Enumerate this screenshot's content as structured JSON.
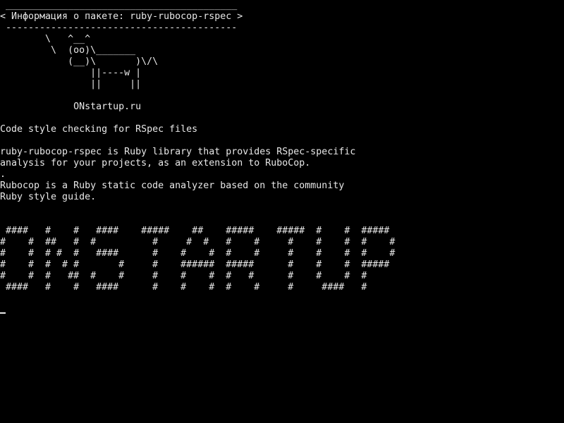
{
  "terminal": {
    "lines": [
      " _________________________________________",
      "< Информация о пакете: ruby-rubocop-rspec >",
      " -----------------------------------------",
      "        \\   ^__^",
      "         \\  (oo)\\_______",
      "            (__)\\       )\\/\\",
      "                ||----w |",
      "                ||     ||",
      "",
      "             ONstartup.ru",
      "",
      "Code style checking for RSpec files",
      "",
      "ruby-rubocop-rspec is Ruby library that provides RSpec-specific",
      "analysis for your projects, as an extension to RuboCop.",
      ".",
      "Rubocop is a Ruby static code analyzer based on the community",
      "Ruby style guide.",
      "",
      "",
      " ####   #    #   ####    #####    ##    #####    #####  #    #  #####",
      "#    #  ##   #  #          #     #  #   #    #     #    #    #  #    #",
      "#    #  # #  #   ####      #    #    #  #    #     #    #    #  #    #",
      "#    #  #  # #       #     #    ######  #####      #    #    #  #####",
      "#    #  #   ##  #    #     #    #    #  #   #      #    #    #  #",
      " ####   #    #   ####      #    #    #  #    #     #     ####   #"
    ],
    "text_color": "#e8e8e8",
    "background_color": "#000000"
  }
}
